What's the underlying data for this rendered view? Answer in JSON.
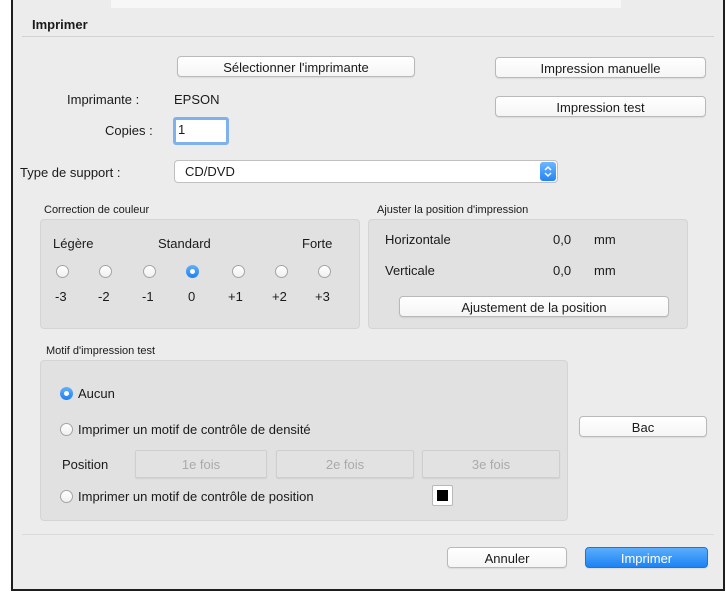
{
  "dialog": {
    "title": "Imprimer"
  },
  "header_buttons": {
    "select_printer": "Sélectionner l'imprimante",
    "manual_print": "Impression manuelle",
    "test_print": "Impression test"
  },
  "printer": {
    "label": "Imprimante :",
    "value": "EPSON"
  },
  "copies": {
    "label": "Copies :",
    "value": "1"
  },
  "media_type": {
    "label": "Type de support :",
    "selected": "CD/DVD"
  },
  "color_correction": {
    "title": "Correction de couleur",
    "left_label": "Légère",
    "center_label": "Standard",
    "right_label": "Forte",
    "options": [
      "-3",
      "-2",
      "-1",
      "0",
      "+1",
      "+2",
      "+3"
    ],
    "selected": "0"
  },
  "position_adjust": {
    "title": "Ajuster la position d'impression",
    "horizontal_label": "Horizontale",
    "horizontal_value": "0,0",
    "horizontal_unit": "mm",
    "vertical_label": "Verticale",
    "vertical_value": "0,0",
    "vertical_unit": "mm",
    "button": "Ajustement de la position"
  },
  "test_pattern": {
    "title": "Motif d'impression test",
    "option_none": "Aucun",
    "option_density": "Imprimer un motif de contrôle de densité",
    "position_label": "Position",
    "positions": [
      "1e fois",
      "2e fois",
      "3e fois"
    ],
    "option_position": "Imprimer un motif de contrôle de position",
    "selected": "Aucun"
  },
  "tray_button": "Bac",
  "footer": {
    "cancel": "Annuler",
    "print": "Imprimer"
  },
  "colors": {
    "accent": "#1d82f3",
    "window_bg": "#ececec",
    "group_bg": "#e1e1e1"
  }
}
